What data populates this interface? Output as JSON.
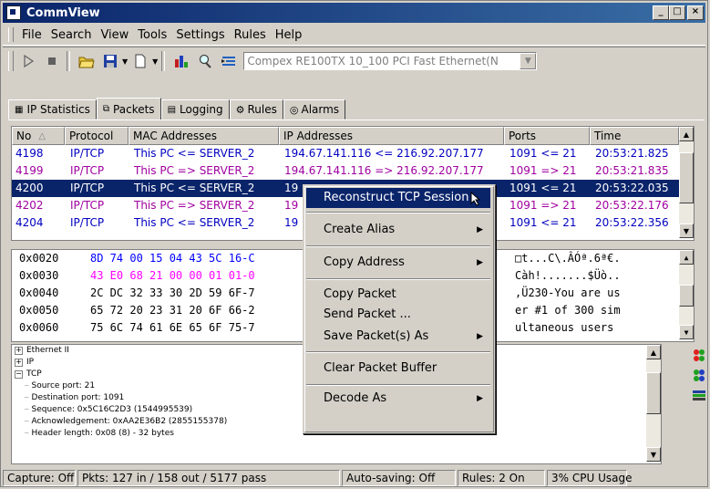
{
  "window": {
    "title": "CommView"
  },
  "menu": [
    "File",
    "Search",
    "View",
    "Tools",
    "Settings",
    "Rules",
    "Help"
  ],
  "adapter": {
    "value": "Compex RE100TX 10_100 PCI Fast Ethernet(N"
  },
  "tabs": [
    {
      "label": "IP Statistics",
      "icon": "table-icon"
    },
    {
      "label": "Packets",
      "icon": "packets-icon"
    },
    {
      "label": "Logging",
      "icon": "logging-icon"
    },
    {
      "label": "Rules",
      "icon": "rules-icon"
    },
    {
      "label": "Alarms",
      "icon": "alarm-icon"
    }
  ],
  "packets": {
    "columns": [
      "No",
      "Protocol",
      "MAC Addresses",
      "IP Addresses",
      "Ports",
      "Time"
    ],
    "rows": [
      [
        "4198",
        "IP/TCP",
        "This PC <= SERVER_2",
        "194.67.141.116 <= 216.92.207.177",
        "1091 <= 21",
        "20:53:21.825"
      ],
      [
        "4199",
        "IP/TCP",
        "This PC => SERVER_2",
        "194.67.141.116 => 216.92.207.177",
        "1091 => 21",
        "20:53:21.835"
      ],
      [
        "4200",
        "IP/TCP",
        "This PC <= SERVER_2",
        "19",
        "1091 <= 21",
        "20:53:22.035"
      ],
      [
        "4202",
        "IP/TCP",
        "This PC => SERVER_2",
        "19",
        "1091 => 21",
        "20:53:22.176"
      ],
      [
        "4204",
        "IP/TCP",
        "This PC <= SERVER_2",
        "19",
        "1091 <= 21",
        "20:53:22.356"
      ]
    ]
  },
  "hex": [
    {
      "offset": "0x0020",
      "bytes": "8D 74 00 15 04 43 5C 16-C",
      "ascii": "□t...C\\.ÂÓª.6ª€."
    },
    {
      "offset": "0x0030",
      "bytes": "43 E0 68 21 00 00 01 01-0",
      "ascii": "Càh!.......$Üò.."
    },
    {
      "offset": "0x0040",
      "bytes": "2C DC 32 33 30 2D 59 6F-7",
      "ascii": ",Ü230-You are us"
    },
    {
      "offset": "0x0050",
      "bytes": "65 72 20 23 31 20 6F 66-2",
      "ascii": "er #1 of 300 sim"
    },
    {
      "offset": "0x0060",
      "bytes": "75 6C 74 61 6E 65 6F 75-7",
      "ascii": "ultaneous users"
    }
  ],
  "tree": [
    {
      "label": "Ethernet II",
      "box": "+",
      "indent": 0
    },
    {
      "label": "IP",
      "box": "+",
      "indent": 0
    },
    {
      "label": "TCP",
      "box": "−",
      "indent": 0
    },
    {
      "label": "Source port: 21",
      "box": "",
      "indent": 1
    },
    {
      "label": "Destination port: 1091",
      "box": "",
      "indent": 1
    },
    {
      "label": "Sequence: 0x5C16C2D3 (1544995539)",
      "box": "",
      "indent": 1
    },
    {
      "label": "Acknowledgement: 0xAA2E36B2 (2855155378)",
      "box": "",
      "indent": 1
    },
    {
      "label": "Header length: 0x08 (8) - 32 bytes",
      "box": "",
      "indent": 1
    }
  ],
  "context_menu": [
    {
      "label": "Reconstruct TCP Session",
      "submenu": false,
      "highlighted": true
    },
    {
      "label": "Create Alias",
      "submenu": true
    },
    {
      "label": "Copy Address",
      "submenu": true
    },
    {
      "label": "Copy Packet",
      "submenu": false
    },
    {
      "label": "Send Packet ...",
      "submenu": false
    },
    {
      "label": "Save Packet(s) As",
      "submenu": true
    },
    {
      "label": "Clear Packet Buffer",
      "submenu": false
    },
    {
      "label": "Decode As",
      "submenu": true
    }
  ],
  "status": {
    "capture": "Capture: Off",
    "packets": "Pkts: 127 in / 158 out / 5177 pass",
    "autosave": "Auto-saving: Off",
    "rules": "Rules: 2 On",
    "cpu": "3% CPU Usage"
  },
  "colors": {
    "selection": "#0a246a",
    "incoming": "#0000c0",
    "outgoing": "#a000a0",
    "hex_blue": "#0000ff",
    "hex_pink": "#ff00ff"
  }
}
